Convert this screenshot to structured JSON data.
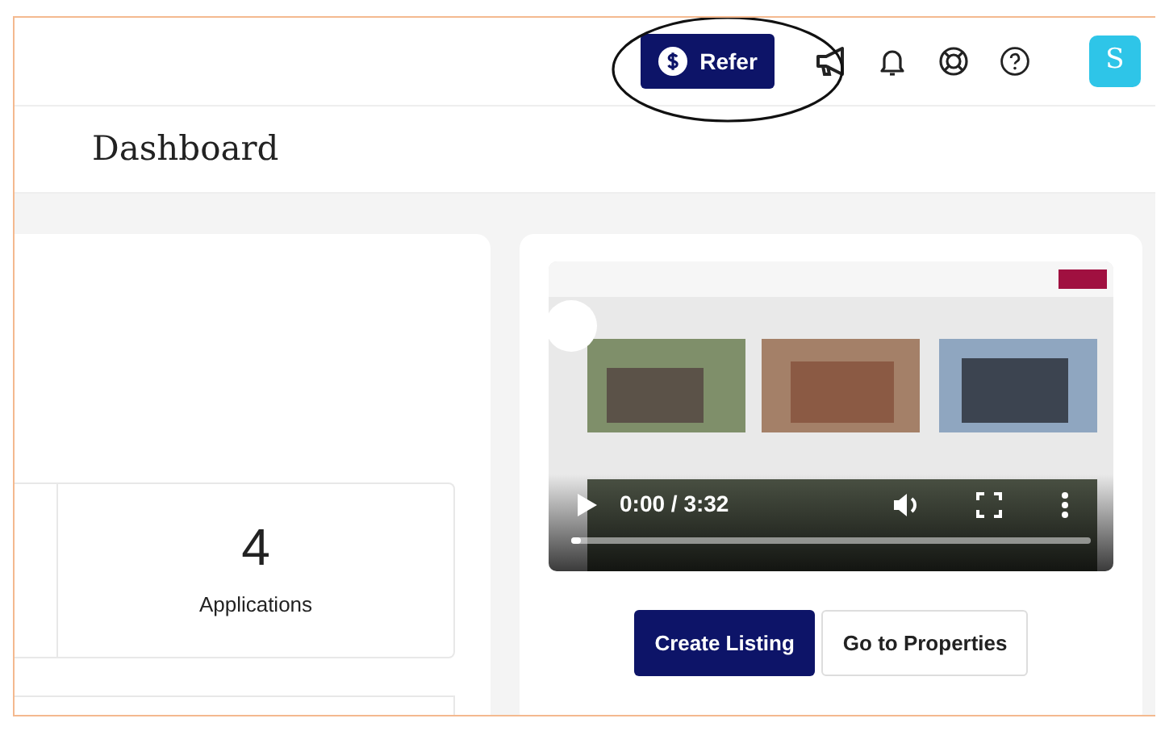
{
  "header": {
    "refer_button": "Refer",
    "avatar": "S"
  },
  "title": "Dashboard",
  "stats": [
    {
      "value": "4",
      "label": "Applications"
    }
  ],
  "video": {
    "kind": "picture",
    "time": "0:00 / 3:32",
    "level": 0.02
  },
  "buttons": [
    {
      "label": "Create Listing",
      "kind": "primary"
    },
    {
      "label": "Go to Properties",
      "kind": "secondary"
    }
  ]
}
